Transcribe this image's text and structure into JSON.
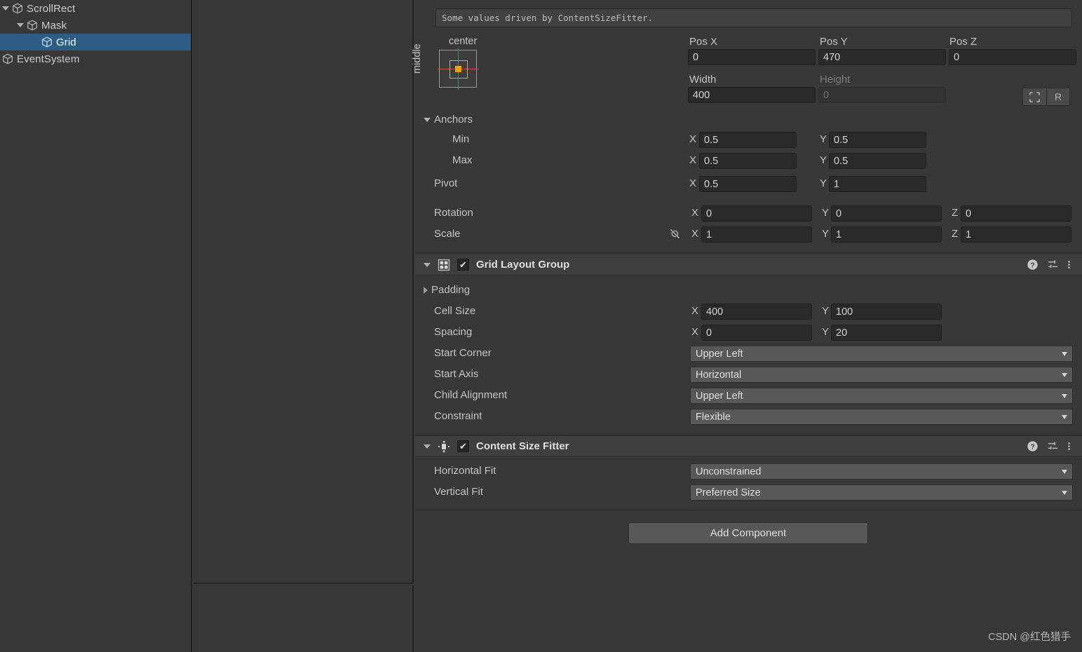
{
  "hierarchy": {
    "items": [
      {
        "label": "ScrollRect",
        "indent": 0,
        "twisty": "down",
        "icon": "cube-icon",
        "selected": false
      },
      {
        "label": "Mask",
        "indent": 1,
        "twisty": "down",
        "icon": "cube-icon",
        "selected": false
      },
      {
        "label": "Grid",
        "indent": 2,
        "twisty": "none",
        "icon": "cube-icon",
        "selected": true
      },
      {
        "label": "EventSystem",
        "indent": -1,
        "twisty": "none",
        "icon": "cube-icon",
        "selected": false
      }
    ],
    "selection_color": "#2c5d87"
  },
  "inspector": {
    "info_message": "Some values driven by ContentSizeFitter.",
    "rect_transform": {
      "anchor_preset": {
        "horizontal": "center",
        "vertical": "middle"
      },
      "pos_x_label": "Pos X",
      "pos_x_value": "0",
      "pos_y_label": "Pos Y",
      "pos_y_value": "470",
      "pos_z_label": "Pos Z",
      "pos_z_value": "0",
      "width_label": "Width",
      "width_value": "400",
      "height_label": "Height",
      "height_value": "0",
      "blueprint_button": "blueprint-icon",
      "raw_button": "R",
      "anchors_label": "Anchors",
      "min_label": "Min",
      "min_x": "0.5",
      "min_y": "0.5",
      "max_label": "Max",
      "max_x": "0.5",
      "max_y": "0.5",
      "pivot_label": "Pivot",
      "pivot_x": "0.5",
      "pivot_y": "1",
      "rotation_label": "Rotation",
      "rot_x": "0",
      "rot_y": "0",
      "rot_z": "0",
      "scale_label": "Scale",
      "scale_x": "1",
      "scale_y": "1",
      "scale_z": "1",
      "axis_x": "X",
      "axis_y": "Y",
      "axis_z": "Z"
    },
    "grid_layout_group": {
      "title": "Grid Layout Group",
      "enabled": true,
      "padding_label": "Padding",
      "cell_size_label": "Cell Size",
      "cell_size_x": "400",
      "cell_size_y": "100",
      "spacing_label": "Spacing",
      "spacing_x": "0",
      "spacing_y": "20",
      "start_corner_label": "Start Corner",
      "start_corner_value": "Upper Left",
      "start_axis_label": "Start Axis",
      "start_axis_value": "Horizontal",
      "child_alignment_label": "Child Alignment",
      "child_alignment_value": "Upper Left",
      "constraint_label": "Constraint",
      "constraint_value": "Flexible"
    },
    "content_size_fitter": {
      "title": "Content Size Fitter",
      "enabled": true,
      "horizontal_fit_label": "Horizontal Fit",
      "horizontal_fit_value": "Unconstrained",
      "vertical_fit_label": "Vertical Fit",
      "vertical_fit_value": "Preferred Size"
    },
    "add_component_label": "Add Component"
  },
  "watermark": "CSDN @红色猎手"
}
